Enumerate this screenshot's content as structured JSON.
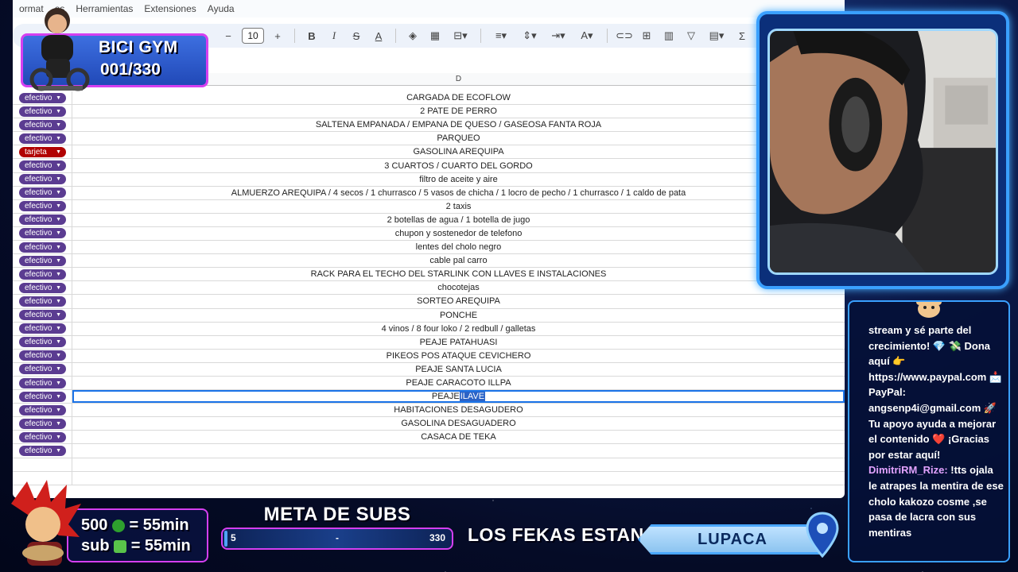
{
  "sheet": {
    "menu": [
      "ormat",
      "os",
      "Herramientas",
      "Extensiones",
      "Ayuda"
    ],
    "toolbar": {
      "font_size": "10"
    },
    "column_header": "D",
    "rows": [
      {
        "pay": "efectivo",
        "desc": "CARGADA DE ECOFLOW"
      },
      {
        "pay": "efectivo",
        "desc": "2 PATE DE PERRO"
      },
      {
        "pay": "efectivo",
        "desc": "SALTENA EMPANADA / EMPANA DE QUESO / GASEOSA FANTA ROJA"
      },
      {
        "pay": "efectivo",
        "desc": "PARQUEO"
      },
      {
        "pay": "tarjeta",
        "desc": "GASOLINA AREQUIPA"
      },
      {
        "pay": "efectivo",
        "desc": "3 CUARTOS / CUARTO DEL GORDO"
      },
      {
        "pay": "efectivo",
        "desc": "filtro de aceite y aire"
      },
      {
        "pay": "efectivo",
        "desc": "ALMUERZO AREQUIPA / 4 secos / 1 churrasco / 5 vasos de chicha / 1 locro de pecho / 1 churrasco / 1 caldo de pata"
      },
      {
        "pay": "efectivo",
        "desc": "2 taxis"
      },
      {
        "pay": "efectivo",
        "desc": "2 botellas de agua / 1 botella de jugo"
      },
      {
        "pay": "efectivo",
        "desc": "chupon y sostenedor de telefono"
      },
      {
        "pay": "efectivo",
        "desc": "lentes del cholo negro"
      },
      {
        "pay": "efectivo",
        "desc": "cable pal carro"
      },
      {
        "pay": "efectivo",
        "desc": "RACK PARA EL TECHO DEL STARLINK CON LLAVES E INSTALACIONES"
      },
      {
        "pay": "efectivo",
        "desc": "chocotejas"
      },
      {
        "pay": "efectivo",
        "desc": "SORTEO AREQUIPA"
      },
      {
        "pay": "efectivo",
        "desc": "PONCHE"
      },
      {
        "pay": "efectivo",
        "desc": "4 vinos / 8 four loko / 2 redbull / galletas"
      },
      {
        "pay": "efectivo",
        "desc": "PEAJE PATAHUASI"
      },
      {
        "pay": "efectivo",
        "desc": "PIKEOS POS ATAQUE CEVICHERO"
      },
      {
        "pay": "efectivo",
        "desc": "PEAJE SANTA LUCIA"
      },
      {
        "pay": "efectivo",
        "desc": "PEAJE CARACOTO ILLPA"
      },
      {
        "pay": "efectivo",
        "desc": "PEAJE ",
        "highlight": "ILAVE"
      },
      {
        "pay": "efectivo",
        "desc": "HABITACIONES DESAGUDERO"
      },
      {
        "pay": "efectivo",
        "desc": "GASOLINA DESAGUADERO"
      },
      {
        "pay": "efectivo",
        "desc": "CASACA DE TEKA"
      },
      {
        "pay": "efectivo",
        "desc": ""
      },
      {
        "pay": "",
        "desc": ""
      },
      {
        "pay": "",
        "desc": ""
      }
    ]
  },
  "overlay": {
    "bici_gym": {
      "title": "BICI GYM",
      "count": "001/330"
    },
    "chat": [
      {
        "user": "",
        "text": "stream y sé parte del crecimiento! 💎 💸 Dona aquí 👉 https://www.paypal.com 📩 PayPal: angsenp4i@gmail.com 🚀 Tu apoyo ayuda a mejorar el contenido ❤️ ¡Gracias por estar aquí!"
      },
      {
        "user": "DimitriRM_Rize:",
        "text": " !tts ojala le atrapes la mentira de ese cholo kakozo cosme ,se pasa de lacra con sus mentiras"
      }
    ],
    "subs_rates": {
      "line1": "500 = 55min",
      "line1_a": "500",
      "line1_b": "= 55min",
      "line2_a": "sub",
      "line2_b": "= 55min"
    },
    "meta_subs": {
      "title": "META DE SUBS",
      "current": "5",
      "goal": "330",
      "middle": "-",
      "progress": 0.015
    },
    "fekas_label": "LOS FEKAS ESTAN EN:",
    "fekas_location": "LUPACA",
    "colors": {
      "efectivo": "#5b3c91",
      "tarjeta": "#b10202",
      "accent_blue": "#3aa0ff",
      "accent_pink": "#d53ff0"
    }
  }
}
